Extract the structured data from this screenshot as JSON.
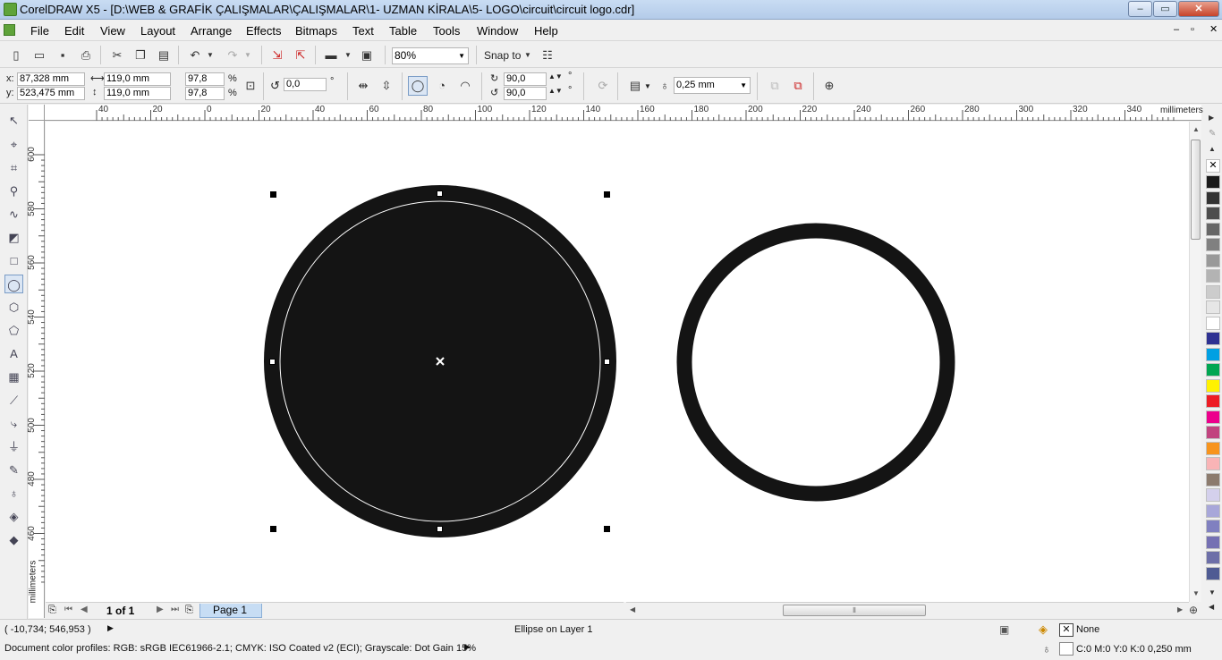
{
  "window": {
    "title": "CorelDRAW X5 - [D:\\WEB & GRAFİK ÇALIŞMALAR\\ÇALIŞMALAR\\1- UZMAN KİRALA\\5- LOGO\\circuit\\circuit logo.cdr]",
    "minimize_label": "–",
    "maximize_label": "▭",
    "close_label": "✕"
  },
  "menu": {
    "items": [
      {
        "label": "File"
      },
      {
        "label": "Edit"
      },
      {
        "label": "View"
      },
      {
        "label": "Layout"
      },
      {
        "label": "Arrange"
      },
      {
        "label": "Effects"
      },
      {
        "label": "Bitmaps"
      },
      {
        "label": "Text"
      },
      {
        "label": "Table"
      },
      {
        "label": "Tools"
      },
      {
        "label": "Window"
      },
      {
        "label": "Help"
      }
    ]
  },
  "toolbar": {
    "zoom_value": "80%",
    "snap_label": "Snap to"
  },
  "property_bar": {
    "x_label": "x:",
    "x_value": "87,328 mm",
    "y_label": "y:",
    "y_value": "523,475 mm",
    "width_value": "119,0 mm",
    "height_value": "119,0 mm",
    "scale_x": "97,8",
    "scale_y": "97,8",
    "percent": "%",
    "rotation_value": "0,0",
    "degree": "°",
    "start_angle": "90,0",
    "end_angle": "90,0",
    "outline_width": "0,25 mm"
  },
  "ruler": {
    "unit": "millimeters",
    "h_ticks": [
      "40",
      "20",
      "0",
      "20",
      "40",
      "60",
      "80",
      "100",
      "120",
      "140",
      "160",
      "180",
      "200",
      "220",
      "240",
      "260",
      "280",
      "300",
      "320",
      "340"
    ],
    "v_ticks": [
      "600",
      "580",
      "560",
      "540",
      "520",
      "500",
      "480",
      "460"
    ]
  },
  "page_nav": {
    "page_count": "1 of 1",
    "page_tab": "Page 1"
  },
  "status": {
    "coords": "( -10,734; 546,953 )",
    "selection_info": "Ellipse on Layer 1",
    "fill_label": "None",
    "outline_info": "C:0 M:0 Y:0 K:0  0,250 mm",
    "color_profiles": "Document color profiles: RGB: sRGB IEC61966-2.1; CMYK: ISO Coated v2 (ECI); Grayscale: Dot Gain 15%"
  },
  "colors": {
    "ellipse_fill": "#141414",
    "palette": [
      "#1a1a1a",
      "#333333",
      "#4d4d4d",
      "#666666",
      "#808080",
      "#999999",
      "#b3b3b3",
      "#cccccc",
      "#e6e6e6",
      "#ffffff",
      "#2e3192",
      "#00a0e3",
      "#00a651",
      "#fff200",
      "#ed1c24",
      "#ec008c",
      "#c1447f",
      "#f7941d",
      "#f9b4b6",
      "#8c7b6e",
      "#d4d0ec",
      "#a8a7d9",
      "#8080c0",
      "#7570b3",
      "#6d6fa8",
      "#4f5b93"
    ]
  }
}
